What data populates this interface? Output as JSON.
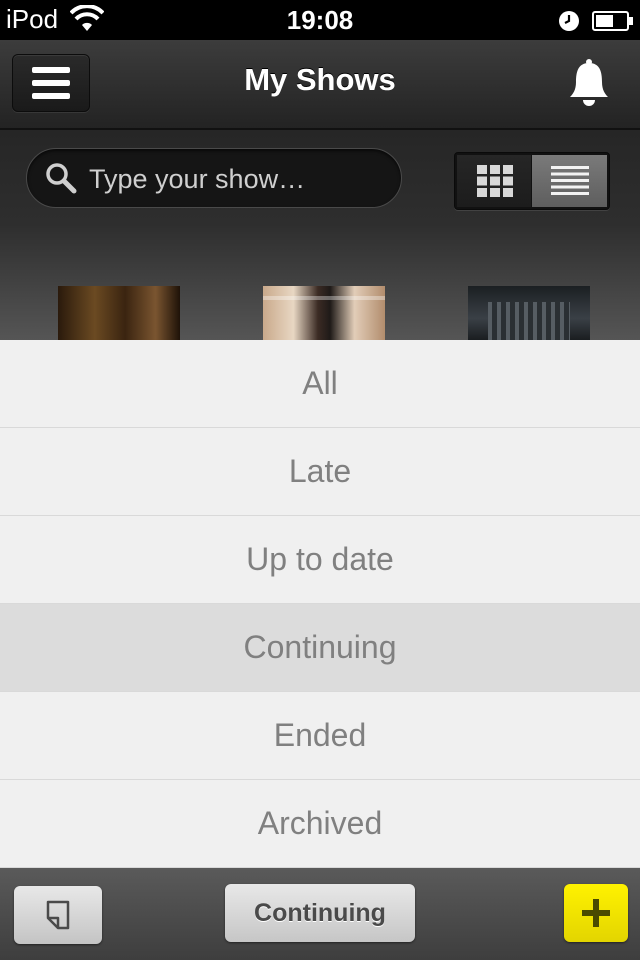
{
  "status_bar": {
    "carrier": "iPod",
    "time": "19:08",
    "icons": [
      "wifi-icon",
      "clock-icon",
      "battery-icon"
    ]
  },
  "nav_bar": {
    "title": "My Shows",
    "left_icon": "hamburger-menu-icon",
    "right_icon": "bell-icon"
  },
  "search": {
    "placeholder": "Type your show…",
    "value": "",
    "icon": "search-icon"
  },
  "view_toggle": {
    "options": [
      "grid-view",
      "list-view"
    ],
    "selected": "list-view"
  },
  "posters": [
    {
      "name": "show-poster-1"
    },
    {
      "name": "show-poster-2"
    },
    {
      "name": "show-poster-3"
    }
  ],
  "filter_menu": {
    "items": [
      "All",
      "Late",
      "Up to date",
      "Continuing",
      "Ended",
      "Archived"
    ],
    "selected": "Continuing"
  },
  "bottom_bar": {
    "filter_label": "Continuing",
    "left_icon": "page-icon",
    "right_icon": "plus-icon"
  },
  "colors": {
    "accent_add": "#f5e600",
    "menu_background": "#f0f0f0",
    "menu_selected": "#dcdcdc",
    "menu_text": "#808080"
  }
}
